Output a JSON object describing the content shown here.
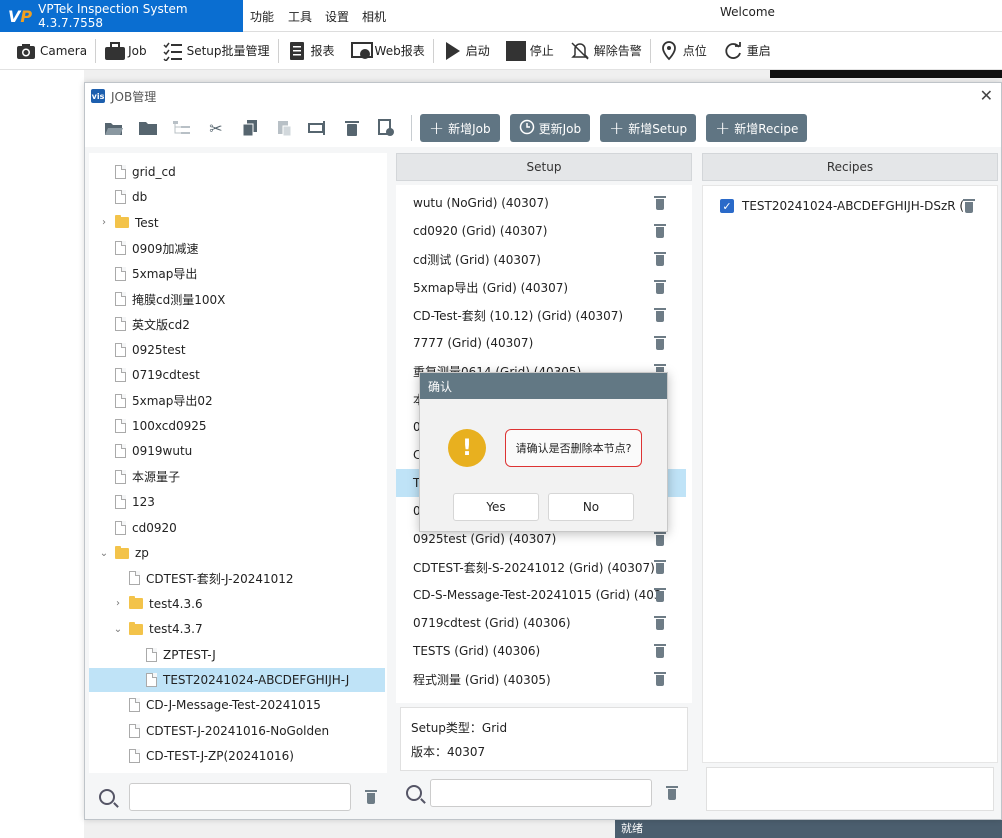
{
  "app": {
    "title": "VPTek Inspection System 4.3.7.7558",
    "menus": [
      "功能",
      "工具",
      "设置",
      "相机"
    ],
    "welcome": "Welcome"
  },
  "main_toolbar": {
    "camera": "Camera",
    "job": "Job",
    "setup_batch": "Setup批量管理",
    "report": "报表",
    "web_report": "Web报表",
    "start": "启动",
    "stop": "停止",
    "clear_alarm": "解除告警",
    "point": "点位",
    "restart": "重启"
  },
  "status_bar": {
    "text": "就绪"
  },
  "job_window": {
    "title": "JOB管理",
    "toolbar_buttons": {
      "new_job": "新增Job",
      "update_job": "更新Job",
      "new_setup": "新增Setup",
      "new_recipe": "新增Recipe"
    },
    "tree": [
      {
        "label": "grid_cd",
        "type": "file",
        "level": 0
      },
      {
        "label": "db",
        "type": "file",
        "level": 0
      },
      {
        "label": "Test",
        "type": "folder",
        "level": 0,
        "expanded": false
      },
      {
        "label": "0909加减速",
        "type": "file",
        "level": 0
      },
      {
        "label": "5xmap导出",
        "type": "file",
        "level": 0
      },
      {
        "label": "掩膜cd测量100X",
        "type": "file",
        "level": 0
      },
      {
        "label": "英文版cd2",
        "type": "file",
        "level": 0
      },
      {
        "label": "0925test",
        "type": "file",
        "level": 0
      },
      {
        "label": "0719cdtest",
        "type": "file",
        "level": 0
      },
      {
        "label": "5xmap导出02",
        "type": "file",
        "level": 0
      },
      {
        "label": "100xcd0925",
        "type": "file",
        "level": 0
      },
      {
        "label": "0919wutu",
        "type": "file",
        "level": 0
      },
      {
        "label": "本源量子",
        "type": "file",
        "level": 0
      },
      {
        "label": "123",
        "type": "file",
        "level": 0
      },
      {
        "label": "cd0920",
        "type": "file",
        "level": 0
      },
      {
        "label": "zp",
        "type": "folder",
        "level": 0,
        "expanded": true
      },
      {
        "label": "CDTEST-套刻-J-20241012",
        "type": "file",
        "level": 1
      },
      {
        "label": "test4.3.6",
        "type": "folder",
        "level": 1,
        "expanded": false
      },
      {
        "label": "test4.3.7",
        "type": "folder",
        "level": 1,
        "expanded": true
      },
      {
        "label": "ZPTEST-J",
        "type": "file",
        "level": 2
      },
      {
        "label": "TEST20241024-ABCDEFGHIJH-J",
        "type": "file",
        "level": 2,
        "selected": true
      },
      {
        "label": "CD-J-Message-Test-20241015",
        "type": "file",
        "level": 1
      },
      {
        "label": "CDTEST-J-20241016-NoGolden",
        "type": "file",
        "level": 1
      },
      {
        "label": "CD-TEST-J-ZP(20241016)",
        "type": "file",
        "level": 1
      }
    ],
    "setup_header": "Setup",
    "setups": [
      "wutu  (NoGrid) (40307)",
      "cd0920 (Grid) (40307)",
      "cd测试 (Grid) (40307)",
      "5xmap导出 (Grid) (40307)",
      "CD-Test-套刻  (10.12)   (Grid) (40307)",
      "7777 (Grid) (40307)",
      "重复测量0614 (Grid) (40305)",
      "本",
      "0",
      "C",
      "T",
      "0",
      "0925test (Grid) (40307)",
      "CDTEST-套刻-S-20241012 (Grid) (40307)",
      "CD-S-Message-Test-20241015 (Grid) (403",
      "0719cdtest (Grid) (40306)",
      "TESTS (Grid) (40306)",
      "程式测量 (Grid) (40305)"
    ],
    "setup_selected_index": 10,
    "setup_info": {
      "type_label": "Setup类型：Grid",
      "version_label": "版本：40307"
    },
    "recipes_header": "Recipes",
    "recipes": [
      {
        "label": "TEST20241024-ABCDEFGHIJH-DSzR (",
        "checked": true
      }
    ]
  },
  "dialog": {
    "title": "确认",
    "message": "请确认是否删除本节点?",
    "yes": "Yes",
    "no": "No"
  }
}
